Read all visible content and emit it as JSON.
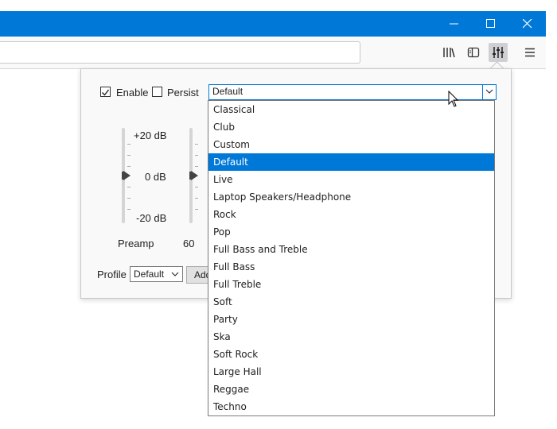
{
  "window": {
    "minimize_icon": "minimize-icon",
    "maximize_icon": "maximize-icon",
    "close_icon": "close-icon",
    "accent": "#0078d7"
  },
  "toolbar": {
    "url_value": "",
    "icons": [
      "library-icon",
      "sidebar-icon",
      "equalizer-icon",
      "hamburger-menu-icon"
    ]
  },
  "panel": {
    "enable_label": "Enable",
    "enable_checked": true,
    "persist_label": "Persist",
    "persist_checked": false,
    "preset_value": "Default",
    "scale_top": "+20 dB",
    "scale_mid": "0 dB",
    "scale_bottom": "-20 dB",
    "preamp_label": "Preamp",
    "band_label": "60",
    "profile_label": "Profile",
    "profile_value": "Default",
    "add_label": "Add"
  },
  "dropdown": {
    "selected": "Default",
    "selected_color": "#0078d7",
    "options": [
      "Classical",
      "Club",
      "Custom",
      "Default",
      "Live",
      "Laptop Speakers/Headphone",
      "Rock",
      "Pop",
      "Full Bass and Treble",
      "Full Bass",
      "Full Treble",
      "Soft",
      "Party",
      "Ska",
      "Soft Rock",
      "Large Hall",
      "Reggae",
      "Techno"
    ]
  }
}
